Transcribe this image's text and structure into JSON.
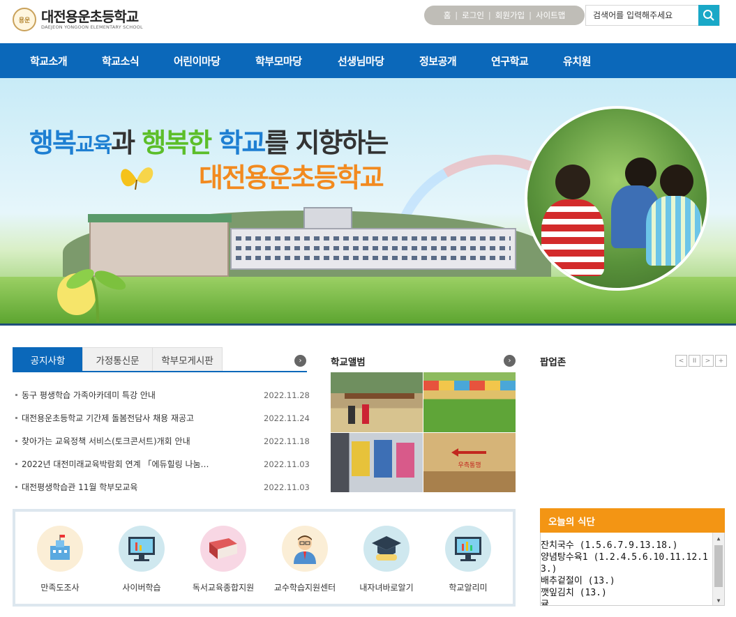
{
  "header": {
    "logo_emblem": "용운",
    "logo_name": "대전용운초등학교",
    "logo_en": "DAEJEON YONGOON ELEMENTARY SCHOOL",
    "util_links": [
      "홈",
      "로그인",
      "회원가입",
      "사이트맵"
    ],
    "search_placeholder": "검색어를 입력해주세요"
  },
  "nav": [
    "학교소개",
    "학교소식",
    "어린이마당",
    "학부모마당",
    "선생님마당",
    "정보공개",
    "연구학교",
    "유치원"
  ],
  "visual": {
    "slogan_line1": [
      "행복",
      "교육",
      "과 ",
      "행복한",
      " 학교",
      "를 지향하는"
    ],
    "slogan_line2": "대전용운초등학교"
  },
  "notice": {
    "tabs": [
      "공지사항",
      "가정통신문",
      "학부모게시판"
    ],
    "items": [
      {
        "title": "동구 평생학습 가족아카데미 특강 안내",
        "date": "2022.11.28"
      },
      {
        "title": "대전용운초등학교 기간제 돌봄전담사 채용 재공고",
        "date": "2022.11.24"
      },
      {
        "title": "찾아가는 교육정책 서비스(토크콘서트)개회 안내",
        "date": "2022.11.18"
      },
      {
        "title": "2022년 대전미래교육박람회 연계 「에듀힐링 나눔…",
        "date": "2022.11.03"
      },
      {
        "title": "대전평생학습관 11월 학부모교육",
        "date": "2022.11.03"
      }
    ]
  },
  "album": {
    "title": "학교앨범",
    "sign_text": "우측통행"
  },
  "popup": {
    "title": "팝업존",
    "controls": [
      "<",
      "II",
      ">",
      "+"
    ]
  },
  "quick_links": [
    "만족도조사",
    "사이버학습",
    "독서교육종합지원",
    "교수학습지원센터",
    "내자녀바로알기",
    "학교알리미"
  ],
  "meal": {
    "title": "오늘의 식단",
    "menu": [
      "잔치국수 (1.5.6.7.9.13.18.)",
      "양념탕수육1 (1.2.4.5.6.10.11.12.13.)",
      "배추겉절이 (13.)",
      "깻잎김치 (13.)",
      "귤"
    ]
  },
  "colors": {
    "nav": "#0b68ba",
    "search_button": "#19a8c7",
    "meal_header": "#f39514"
  }
}
